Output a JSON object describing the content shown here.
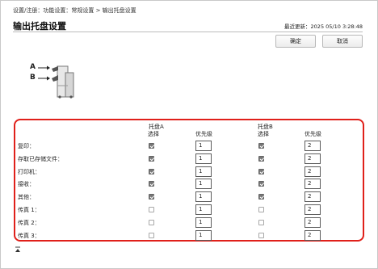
{
  "breadcrumb": "设置/注册：功能设置：常规设置 > 输出托盘设置",
  "title": "输出托盘设置",
  "last_updated": "最近更新：2025 05/10 3:28:48",
  "buttons": {
    "ok": "确定",
    "cancel": "取消"
  },
  "diagram": {
    "label_a": "A",
    "label_b": "B",
    "icon": "finisher-output-trays-icon"
  },
  "trays": [
    {
      "name": "托盘A",
      "select_header": "选择",
      "priority_header": "优先级"
    },
    {
      "name": "托盘B",
      "select_header": "选择",
      "priority_header": "优先级"
    }
  ],
  "rows": [
    {
      "label": "复印：",
      "a_checked": true,
      "a_priority": "1",
      "b_checked": true,
      "b_priority": "2"
    },
    {
      "label": "存取已存储文件：",
      "a_checked": true,
      "a_priority": "1",
      "b_checked": true,
      "b_priority": "2"
    },
    {
      "label": "打印机：",
      "a_checked": true,
      "a_priority": "1",
      "b_checked": true,
      "b_priority": "2"
    },
    {
      "label": "接收：",
      "a_checked": true,
      "a_priority": "1",
      "b_checked": true,
      "b_priority": "2"
    },
    {
      "label": "其他：",
      "a_checked": true,
      "a_priority": "1",
      "b_checked": true,
      "b_priority": "2"
    },
    {
      "label": "传真 1：",
      "a_checked": false,
      "a_priority": "1",
      "b_checked": false,
      "b_priority": "2"
    },
    {
      "label": "传真 2：",
      "a_checked": false,
      "a_priority": "1",
      "b_checked": false,
      "b_priority": "2"
    },
    {
      "label": "传真 3：",
      "a_checked": false,
      "a_priority": "1",
      "b_checked": false,
      "b_priority": "2"
    }
  ],
  "colors": {
    "highlight_border": "#e0201a",
    "checkbox_on": "#777777"
  }
}
